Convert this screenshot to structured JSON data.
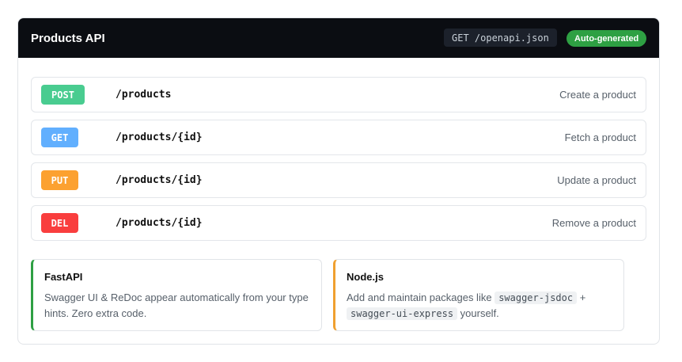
{
  "header": {
    "title": "Products API",
    "endpoint": "GET /openapi.json",
    "badge": "Auto-generated"
  },
  "routes": [
    {
      "method": "POST",
      "color": "#49cc90",
      "path": "/products",
      "description": "Create a product"
    },
    {
      "method": "GET",
      "color": "#61affe",
      "path": "/products/{id}",
      "description": "Fetch a product"
    },
    {
      "method": "PUT",
      "color": "#fca130",
      "path": "/products/{id}",
      "description": "Update a product"
    },
    {
      "method": "DEL",
      "color": "#f93e3e",
      "path": "/products/{id}",
      "description": "Remove a product"
    }
  ],
  "notes": {
    "fastapi": {
      "title": "FastAPI",
      "body": "Swagger UI & ReDoc appear automatically from your type hints. Zero extra code."
    },
    "node": {
      "title": "Node.js",
      "body_prefix": "Add and maintain packages like ",
      "package_1": "swagger-jsdoc",
      "joiner": " + ",
      "package_2": "swagger-ui-express",
      "body_suffix": " yourself."
    }
  }
}
